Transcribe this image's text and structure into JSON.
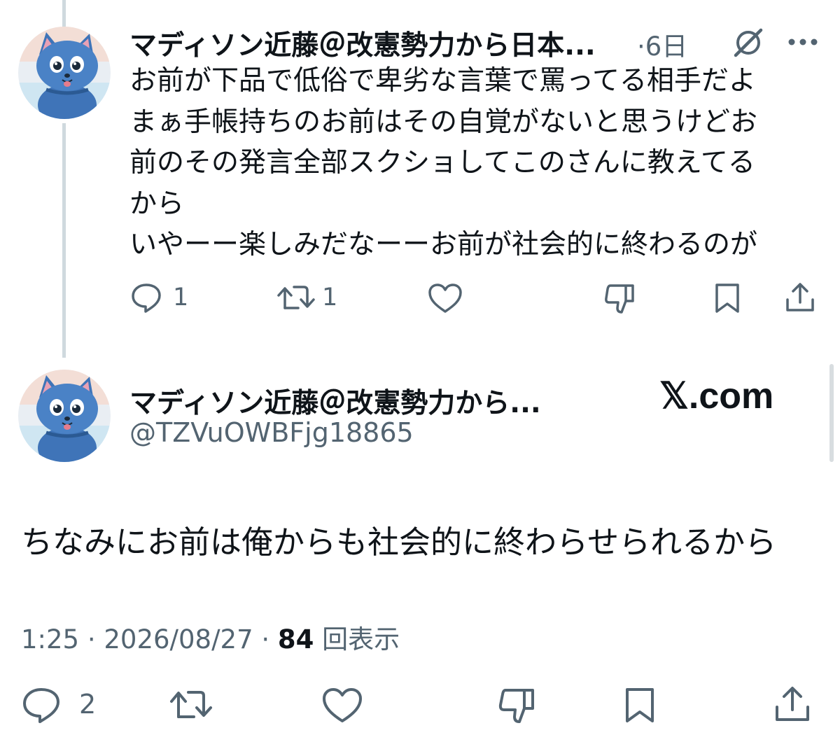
{
  "reply_tweet": {
    "author_name": "マディソン近藤＠改憲勢力から日本...",
    "time_ago": "·6日",
    "body_lines": [
      "お前が下品で低俗で卑劣な言葉で罵ってる相手だよ",
      "まぁ手帳持ちのお前はその自覚がないと思うけどお",
      "前のその発言全部スクショしてこのさんに教えてる",
      "から",
      "いやーー楽しみだなーーお前が社会的に終わるのが"
    ],
    "replies": "1",
    "reposts": "1"
  },
  "main_tweet": {
    "author_name": "マディソン近藤＠改憲勢力から...",
    "handle": "@TZVuOWBFjg18865",
    "watermark": "𝕏.com",
    "text": "ちなみにお前は俺からも社会的に終わらせられるから",
    "time": "1:25 · 2026/08/27 · ",
    "views_count": "84",
    "views_label": " 回表示",
    "replies": "2"
  },
  "icons": [
    "grok-icon",
    "more-icon",
    "reply-icon",
    "retweet-icon",
    "like-icon",
    "dislike-icon",
    "bookmark-icon",
    "share-icon"
  ]
}
